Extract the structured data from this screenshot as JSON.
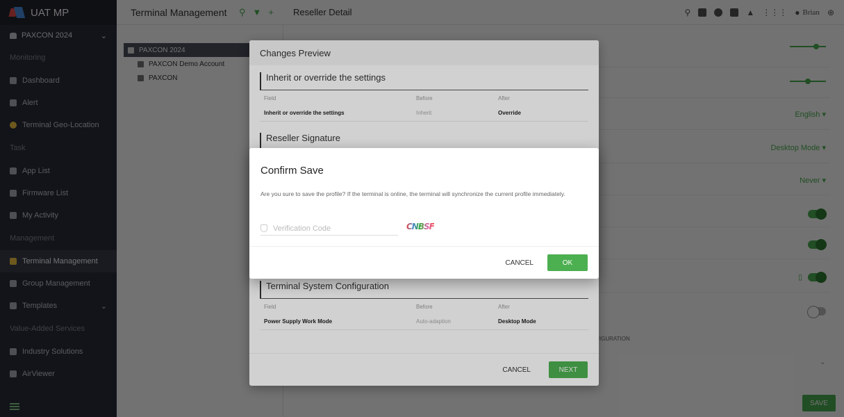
{
  "app": {
    "brand": "UAT MP"
  },
  "sidebar": {
    "reseller": "PAXCON 2024",
    "sections": {
      "monitoring": "Monitoring",
      "task": "Task",
      "management": "Management",
      "vas": "Value-Added Services"
    },
    "items": {
      "dashboard": "Dashboard",
      "alert": "Alert",
      "geo": "Terminal Geo-Location",
      "applist": "App List",
      "firmware": "Firmware List",
      "activity": "My Activity",
      "terminal_mgmt": "Terminal Management",
      "group_mgmt": "Group Management",
      "templates": "Templates",
      "industry": "Industry Solutions",
      "airviewer": "AirViewer"
    }
  },
  "topbar": {
    "title": "Terminal Management",
    "subtitle": "Reseller Detail",
    "user": "Brian"
  },
  "tree": {
    "root": "PAXCON 2024",
    "children": [
      "PAXCON Demo Account",
      "PAXCON"
    ]
  },
  "content": {
    "language": "English ▾",
    "power_mode": "Desktop Mode ▾",
    "never": "Never ▾",
    "config_partial": "FIGURATION",
    "save_label": "SAVE"
  },
  "preview": {
    "title": "Changes Preview",
    "section1": {
      "title": "Inherit or override the settings",
      "headers": [
        "Field",
        "Before",
        "After"
      ],
      "rows": [
        {
          "field": "Inherit or override the settings",
          "before": "Inherit",
          "after": "Override"
        }
      ]
    },
    "section2_title": "Reseller Signature",
    "section3": {
      "title": "Terminal System Configuration",
      "headers": [
        "Field",
        "Before",
        "After"
      ],
      "rows": [
        {
          "field": "Power Supply Work Mode",
          "before": "Auto-adaption",
          "after": "Desktop Mode"
        }
      ]
    },
    "cancel_label": "CANCEL",
    "next_label": "NEXT"
  },
  "confirm": {
    "title": "Confirm Save",
    "message": "Are you sure to save the profile? If the terminal is online, the terminal will synchronize the current profile immediately.",
    "code_placeholder": "Verification Code",
    "captcha": "CNBSF",
    "cancel_label": "CANCEL",
    "ok_label": "OK"
  }
}
